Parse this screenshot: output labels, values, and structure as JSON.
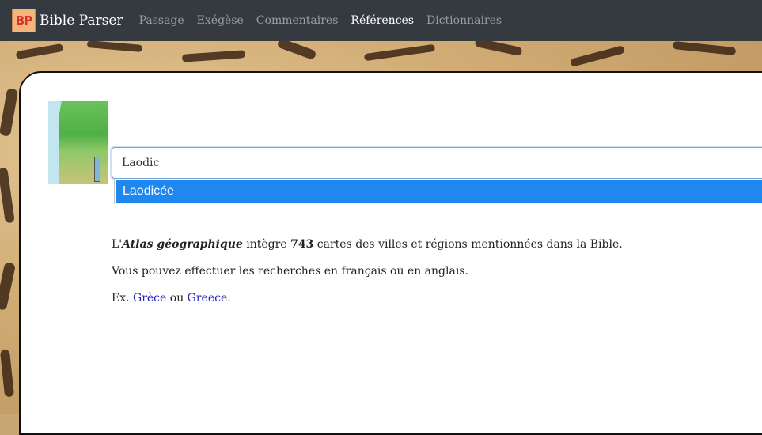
{
  "navbar": {
    "logo_text": "BP",
    "brand": "Bible Parser",
    "links": [
      {
        "label": "Passage"
      },
      {
        "label": "Exégèse"
      },
      {
        "label": "Commentaires"
      },
      {
        "label": "Références",
        "active": true
      },
      {
        "label": "Dictionnaires"
      }
    ]
  },
  "search": {
    "value": "Laodic",
    "suggestions": [
      "Laodicée"
    ]
  },
  "info": {
    "line1_prefix": "L'",
    "line1_atlas": "Atlas géographique",
    "line1_mid": " intègre ",
    "line1_count": "743",
    "line1_suffix": " cartes des villes et régions mentionnées dans la Bible.",
    "line2": "Vous pouvez effectuer les recherches en français ou en anglais.",
    "line3_prefix": "Ex. ",
    "example1": "Grèce",
    "line3_mid": " ou ",
    "example2": "Greece",
    "line3_suffix": "."
  },
  "colors": {
    "navbar_bg": "#343a40",
    "suggestion_highlight": "#1e88f0",
    "link": "#2323c0"
  }
}
